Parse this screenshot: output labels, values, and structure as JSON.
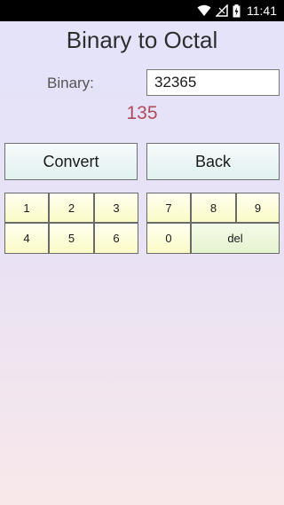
{
  "status_bar": {
    "time": "11:41",
    "icons": [
      "wifi-icon",
      "signal-icon",
      "battery-icon"
    ]
  },
  "title": "Binary to Octal",
  "binary_label": "Binary:",
  "binary_value": "32365",
  "result": "135",
  "buttons": {
    "convert": "Convert",
    "back": "Back"
  },
  "keypad": {
    "k1": "1",
    "k2": "2",
    "k3": "3",
    "k4": "4",
    "k5": "5",
    "k6": "6",
    "k7": "7",
    "k8": "8",
    "k9": "9",
    "k0": "0",
    "del": "del"
  },
  "colors": {
    "result": "#b04a5a",
    "key_bg": "#fafac6",
    "button_bg": "#e2f0f0"
  }
}
